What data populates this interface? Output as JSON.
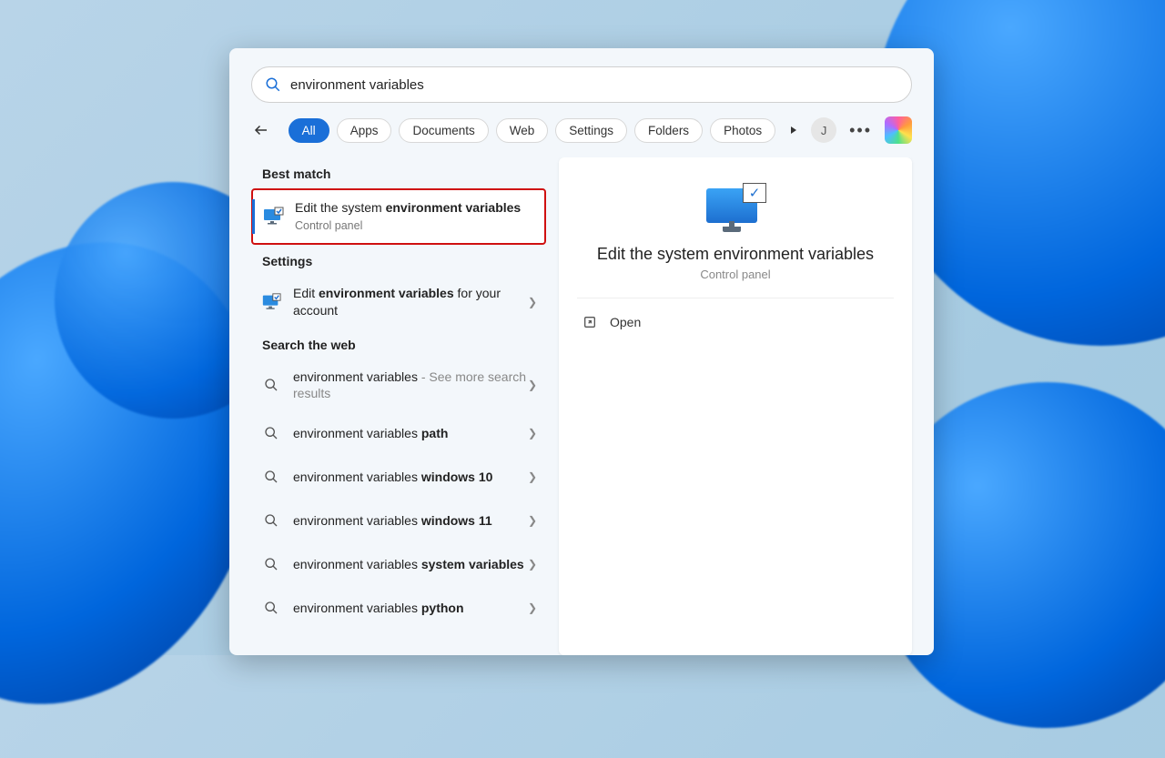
{
  "search": {
    "query": "environment variables"
  },
  "filters": {
    "all": "All",
    "apps": "Apps",
    "documents": "Documents",
    "web": "Web",
    "settings": "Settings",
    "folders": "Folders",
    "photos": "Photos"
  },
  "user_initial": "J",
  "sections": {
    "best_match": "Best match",
    "settings": "Settings",
    "search_web": "Search the web"
  },
  "best_match": {
    "prefix": "Edit the system ",
    "bold": "environment variables",
    "sub": "Control panel"
  },
  "settings_item": {
    "prefix": "Edit ",
    "bold": "environment variables",
    "suffix": " for your account"
  },
  "web_items": [
    {
      "term": "environment variables",
      "suffix": " - See more search results",
      "bold_suffix": ""
    },
    {
      "term": "environment variables ",
      "suffix": "",
      "bold_suffix": "path"
    },
    {
      "term": "environment variables ",
      "suffix": "",
      "bold_suffix": "windows 10"
    },
    {
      "term": "environment variables ",
      "suffix": "",
      "bold_suffix": "windows 11"
    },
    {
      "term": "environment variables ",
      "suffix": "",
      "bold_suffix": "system variables"
    },
    {
      "term": "environment variables ",
      "suffix": "",
      "bold_suffix": "python"
    }
  ],
  "preview": {
    "title": "Edit the system environment variables",
    "sub": "Control panel",
    "open": "Open"
  }
}
